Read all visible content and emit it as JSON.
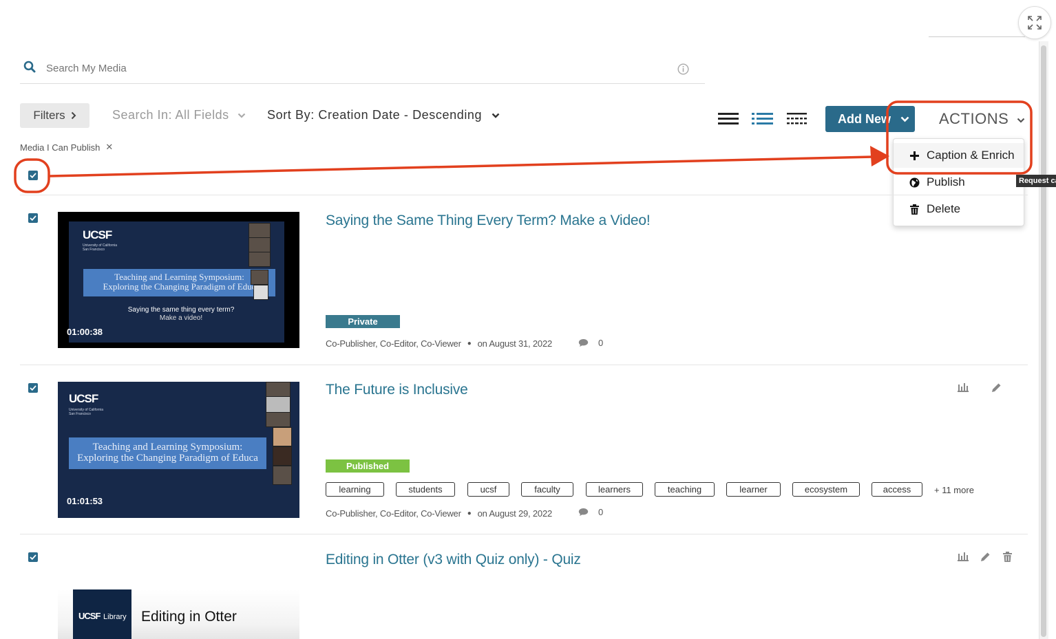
{
  "search": {
    "placeholder": "Search My Media"
  },
  "toolbar": {
    "filters_label": "Filters",
    "search_in": "Search In: All Fields",
    "sort_by": "Sort By: Creation Date - Descending",
    "add_new_label": "Add New",
    "actions_label": "ACTIONS"
  },
  "actions_menu": {
    "items": [
      {
        "label": "Caption & Enrich",
        "icon": "plus-icon"
      },
      {
        "label": "Publish",
        "icon": "globe-icon"
      },
      {
        "label": "Delete",
        "icon": "trash-icon"
      }
    ],
    "tooltip": "Request ca"
  },
  "active_filter": {
    "label": "Media I Can Publish"
  },
  "colors": {
    "accent": "#2a6a8a",
    "title_link": "#2a7590",
    "private_badge": "#3a7a8e",
    "published_badge": "#7cc242",
    "callout": "#e2401e"
  },
  "media": [
    {
      "title": "Saying the Same Thing Every Term? Make a Video!",
      "status": "Private",
      "duration": "01:00:38",
      "thumb_logo": "UCSF",
      "thumb_logo_sub": "University of California San Francisco",
      "thumb_heading_1": "Teaching and Learning Symposium:",
      "thumb_heading_2": "Exploring the Changing Paradigm of Educ",
      "thumb_caption_1": "Saying the same thing every term?",
      "thumb_caption_2": "Make a video!",
      "roles": "Co-Publisher, Co-Editor, Co-Viewer",
      "date": "on August 31, 2022",
      "comments": "0",
      "tags": []
    },
    {
      "title": "The Future is Inclusive",
      "status": "Published",
      "duration": "01:01:53",
      "thumb_logo": "UCSF",
      "thumb_logo_sub": "University of California San Francisco",
      "thumb_heading_1": "Teaching and Learning Symposium:",
      "thumb_heading_2": "Exploring the Changing Paradigm of Educa",
      "roles": "Co-Publisher, Co-Editor, Co-Viewer",
      "date": "on August 29, 2022",
      "comments": "0",
      "tags": [
        "learning",
        "students",
        "ucsf",
        "faculty",
        "learners",
        "teaching",
        "learner",
        "ecosystem",
        "access"
      ],
      "more_tags": "+ 11 more"
    },
    {
      "title": "Editing in Otter (v3 with Quiz only) - Quiz",
      "thumb_logo": "UCSF",
      "thumb_logo_suffix": "Library",
      "thumb_heading": "Editing in Otter"
    }
  ]
}
